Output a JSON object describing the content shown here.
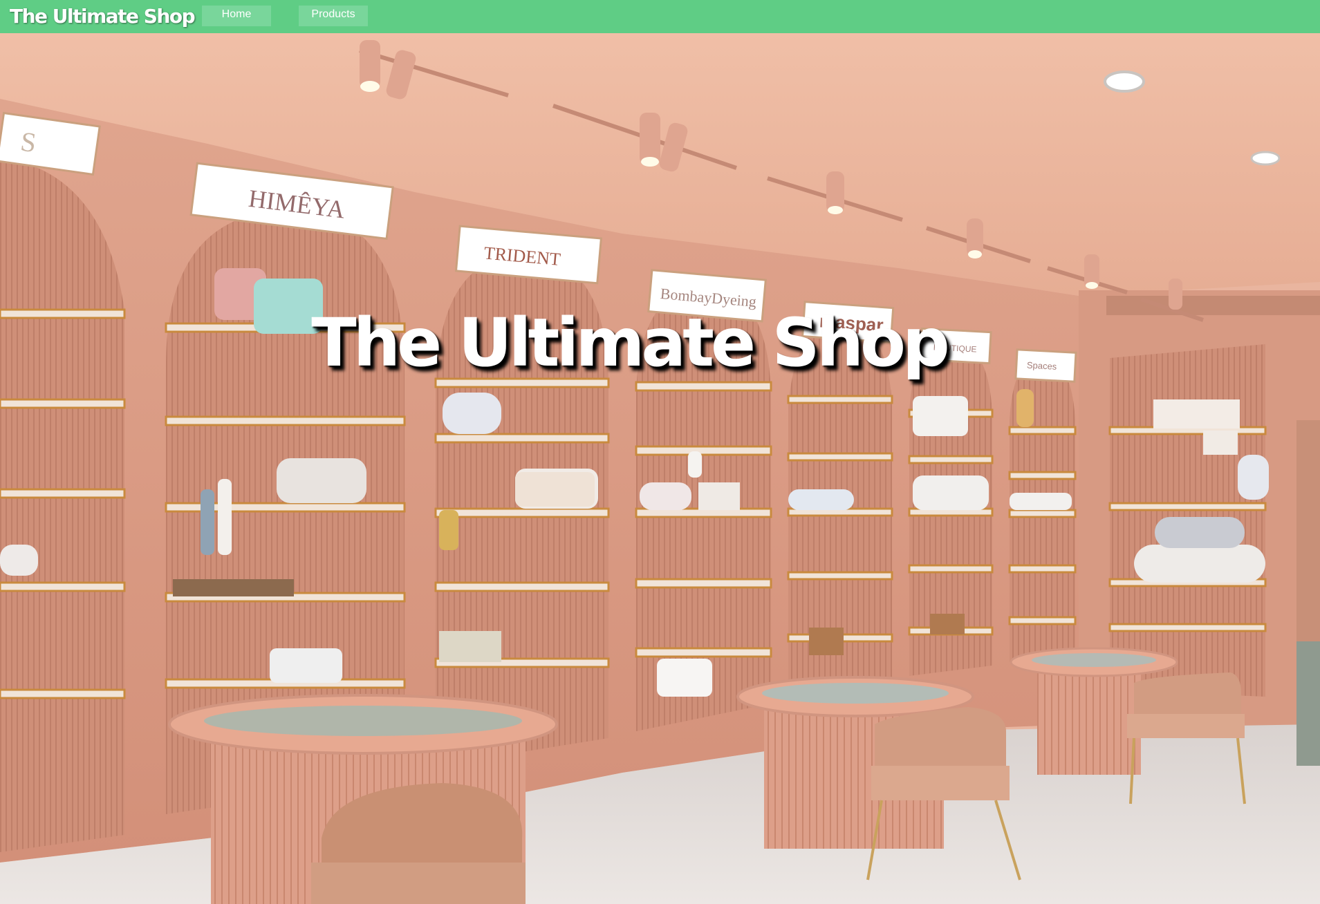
{
  "header": {
    "brand": "The Ultimate Shop",
    "nav": [
      {
        "label": "Home"
      },
      {
        "label": "Products"
      }
    ]
  },
  "hero": {
    "title": "The Ultimate Shop",
    "image_alt": "Pink retail store interior with arched shelves of bedding and towels",
    "signs": [
      "S",
      "HIMÊYA",
      "TRIDENT",
      "BombayDyeing",
      "maspar",
      "BOUTIQUE",
      "Spaces"
    ]
  },
  "colors": {
    "header_bg": "#5fcd85",
    "nav_button_bg": "#79d69b",
    "header_text": "#ffffff"
  }
}
